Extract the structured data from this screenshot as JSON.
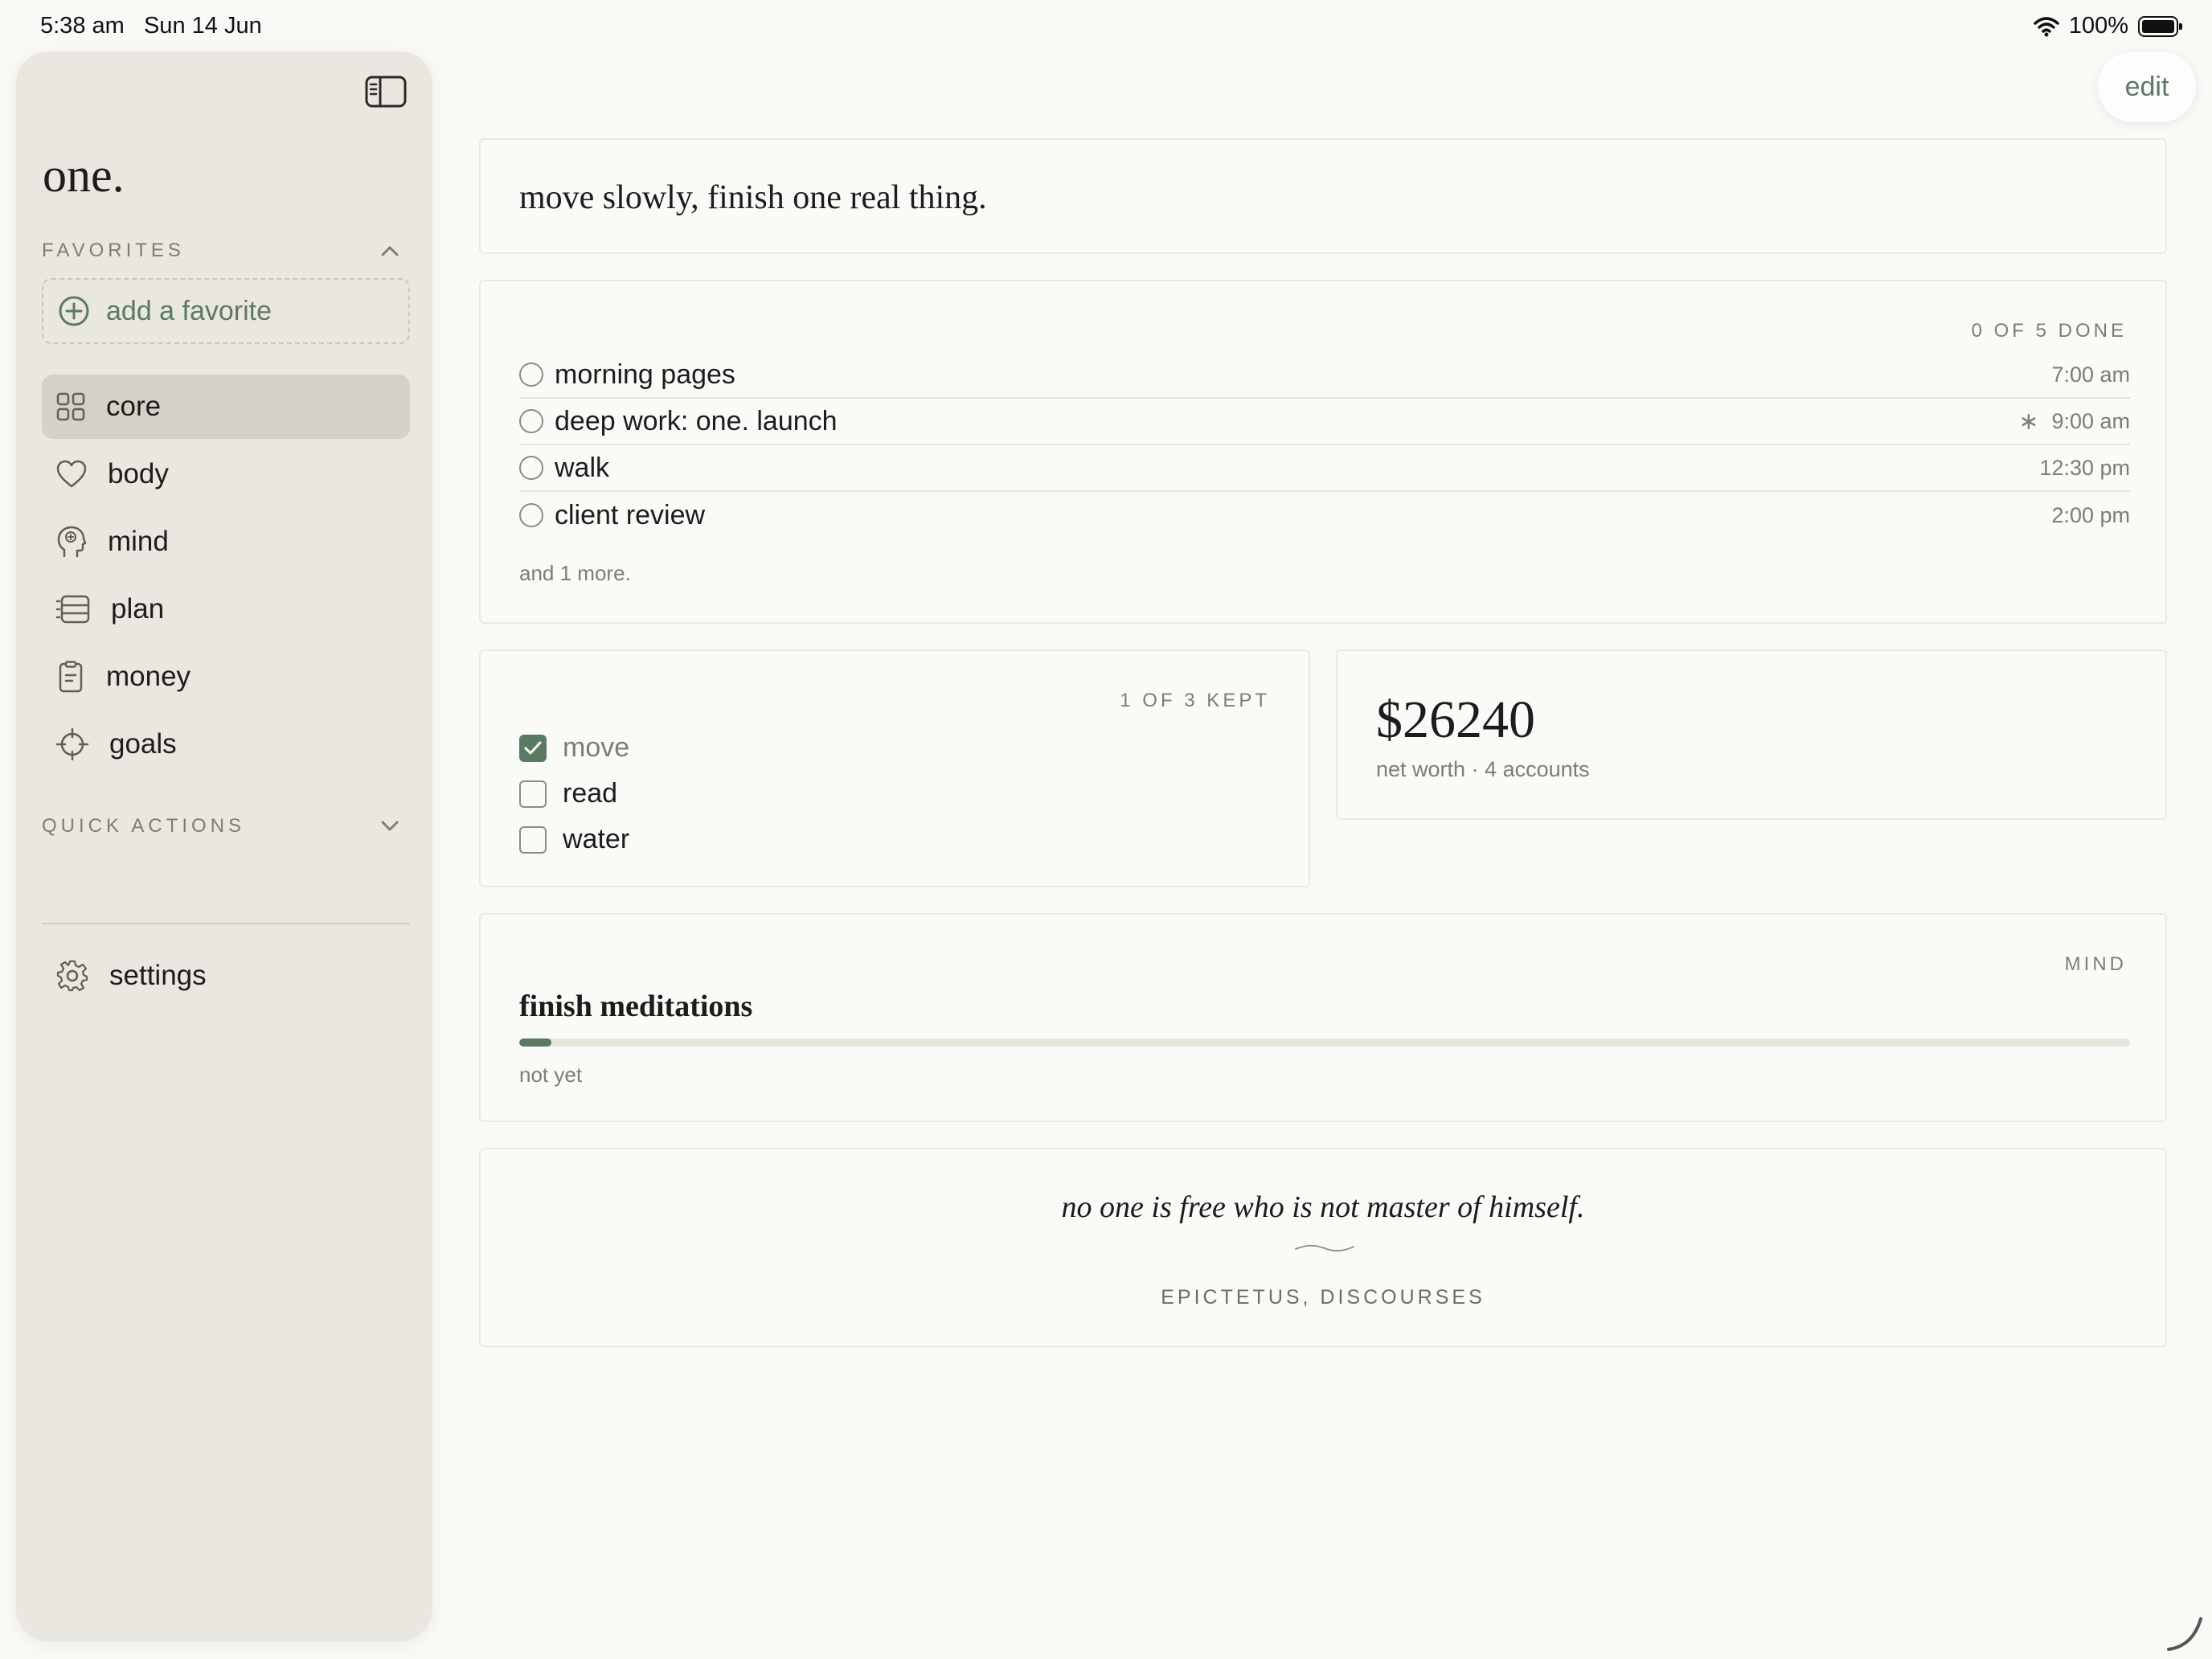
{
  "status_bar": {
    "time": "5:38 am",
    "date": "Sun 14 Jun",
    "battery": "100%",
    "battery_level": 1.0
  },
  "sidebar": {
    "brand": "one.",
    "favorites": {
      "heading": "FAVORITES",
      "add_label": "add a favorite"
    },
    "nav": [
      {
        "label": "core",
        "icon": "grid-icon",
        "active": true
      },
      {
        "label": "body",
        "icon": "heart-icon"
      },
      {
        "label": "mind",
        "icon": "brain-head-icon"
      },
      {
        "label": "plan",
        "icon": "list-icon"
      },
      {
        "label": "money",
        "icon": "receipt-icon"
      },
      {
        "label": "goals",
        "icon": "crosshair-icon"
      }
    ],
    "quick_actions": {
      "heading": "QUICK ACTIONS"
    },
    "settings": {
      "label": "settings",
      "icon": "gear-icon"
    }
  },
  "toolbar": {
    "edit_label": "edit"
  },
  "intention": {
    "text": "move slowly, finish one real thing."
  },
  "tasks": {
    "summary": "0 OF 5 DONE",
    "items": [
      {
        "name": "morning pages",
        "time": "7:00 am",
        "starred": false
      },
      {
        "name": "deep work: one. launch",
        "time": "9:00 am",
        "starred": true
      },
      {
        "name": "walk",
        "time": "12:30 pm",
        "starred": false
      },
      {
        "name": "client review",
        "time": "2:00 pm",
        "starred": false
      }
    ],
    "more": "and 1 more."
  },
  "habits": {
    "summary": "1 OF 3 KEPT",
    "items": [
      {
        "name": "move",
        "checked": true
      },
      {
        "name": "read",
        "checked": false
      },
      {
        "name": "water",
        "checked": false
      }
    ]
  },
  "net_worth": {
    "amount": "$26240",
    "sub": "net worth · 4 accounts"
  },
  "goal": {
    "category": "MIND",
    "title": "finish meditations",
    "progress": 0.02,
    "status": "not yet"
  },
  "quote": {
    "text": "no one is free who is not master of himself.",
    "author": "EPICTETUS, DISCOURSES"
  },
  "colors": {
    "accent": "#5b7a63",
    "sidebar_bg": "#eae7e0",
    "page_bg": "#f9f9f6",
    "muted_text": "#7e7c74"
  }
}
